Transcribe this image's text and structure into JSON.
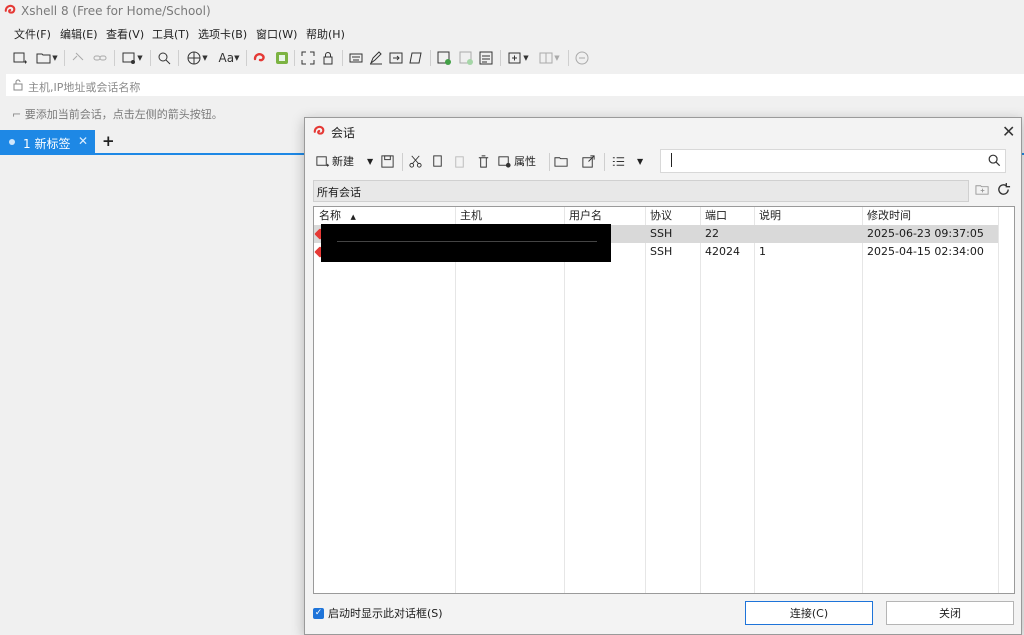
{
  "app": {
    "title": "Xshell 8 (Free for Home/School)"
  },
  "menu": [
    "文件(F)",
    "编辑(E)",
    "查看(V)",
    "工具(T)",
    "选项卡(B)",
    "窗口(W)",
    "帮助(H)"
  ],
  "address": {
    "placeholder": "主机,IP地址或会话名称"
  },
  "hint": "要添加当前会话，点击左侧的箭头按钮。",
  "tabs": {
    "active_label": "1 新标签",
    "add": "+"
  },
  "dialog": {
    "title": "会话",
    "toolbar": {
      "new_label": "新建",
      "properties_label": "属性"
    },
    "folder": "所有会话",
    "columns": [
      "名称",
      "主机",
      "用户名",
      "协议",
      "端口",
      "说明",
      "修改时间"
    ],
    "rows": [
      {
        "protocol": "SSH",
        "port": "22",
        "desc": "",
        "modified": "2025-06-23 09:37:05"
      },
      {
        "protocol": "SSH",
        "port": "42024",
        "desc": "1",
        "modified": "2025-04-15 02:34:00"
      }
    ],
    "startup_checkbox": "启动时显示此对话框(S)",
    "connect_label": "连接(C)",
    "close_label": "关闭"
  },
  "colors": {
    "accent": "#1e88e5",
    "selected_row": "#d9d9d9",
    "brand_red": "#e53935"
  }
}
